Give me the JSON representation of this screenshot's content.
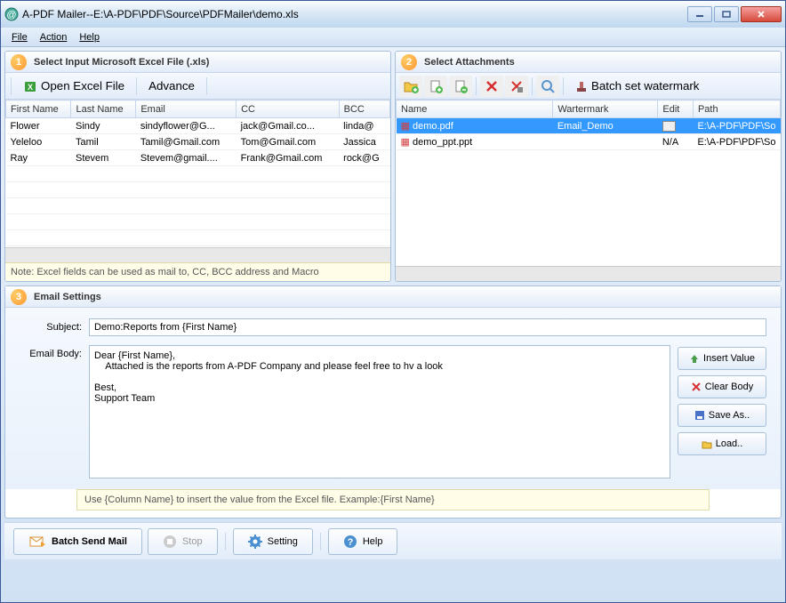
{
  "window": {
    "title": "A-PDF Mailer--E:\\A-PDF\\PDF\\Source\\PDFMailer\\demo.xls"
  },
  "menubar": [
    "File",
    "Action",
    "Help"
  ],
  "panel1": {
    "num": "1",
    "title": "Select Input Microsoft Excel File (.xls)",
    "open_btn": "Open Excel File",
    "advance_btn": "Advance",
    "columns": [
      "First Name",
      "Last Name",
      "Email",
      "CC",
      "BCC"
    ],
    "rows": [
      [
        "Flower",
        "Sindy",
        "sindyflower@G...",
        "jack@Gmail.co...",
        "linda@"
      ],
      [
        "Yeleloo",
        "Tamil",
        "Tamil@Gmail.com",
        "Tom@Gmail.com",
        "Jassica"
      ],
      [
        "Ray",
        "Stevem",
        "Stevem@gmail....",
        "Frank@Gmail.com",
        "rock@G"
      ]
    ],
    "note": "Note: Excel fields can be used as mail to, CC, BCC address and Macro"
  },
  "panel2": {
    "num": "2",
    "title": "Select Attachments",
    "batch_watermark": "Batch set watermark",
    "columns": [
      "Name",
      "Wartermark",
      "Edit",
      "Path"
    ],
    "rows": [
      {
        "name": "demo.pdf",
        "watermark": "Email_Demo",
        "edit": "...",
        "path": "E:\\A-PDF\\PDF\\So",
        "sel": true
      },
      {
        "name": "demo_ppt.ppt",
        "watermark": "",
        "edit": "N/A",
        "path": "E:\\A-PDF\\PDF\\So",
        "sel": false
      }
    ]
  },
  "panel3": {
    "num": "3",
    "title": "Email Settings",
    "subject_label": "Subject:",
    "subject_value": "Demo:Reports from {First Name}",
    "body_label": "Email Body:",
    "body_value": "Dear {First Name},\n    Attached is the reports from A-PDF Company and please feel free to hv a look\n\nBest,\nSupport Team",
    "insert_btn": "Insert Value",
    "clear_btn": "Clear Body",
    "save_btn": "Save As..",
    "load_btn": "Load..",
    "hint": "Use {Column Name} to insert the value from the Excel file. Example:{First Name}"
  },
  "bottom": {
    "send": "Batch Send Mail",
    "stop": "Stop",
    "setting": "Setting",
    "help": "Help"
  }
}
